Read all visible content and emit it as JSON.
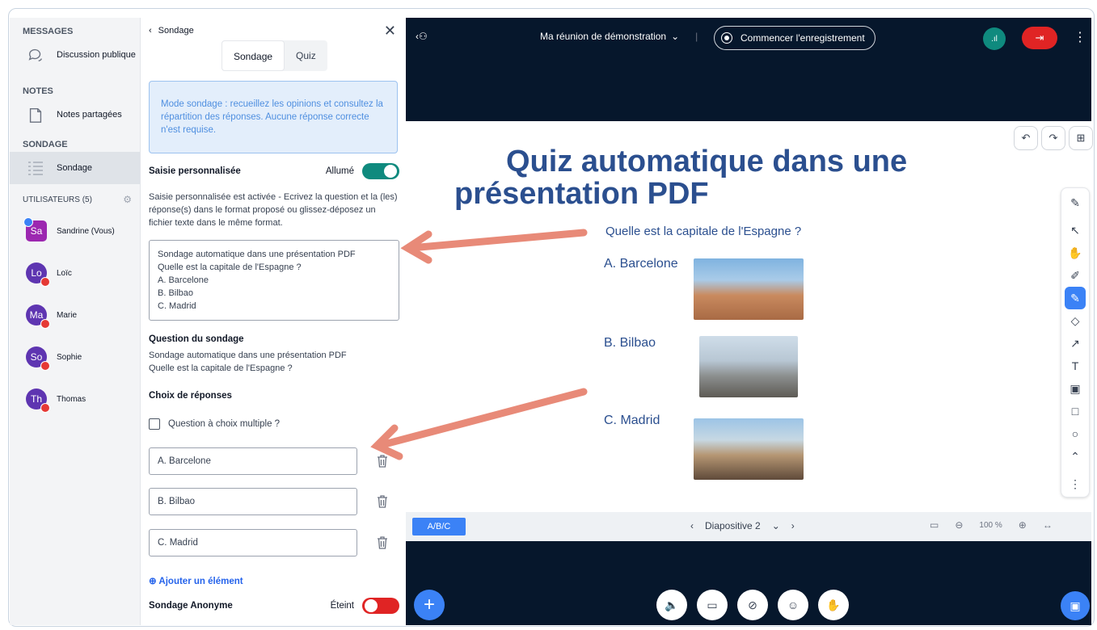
{
  "sidebar": {
    "messages_title": "MESSAGES",
    "public_chat": "Discussion publique",
    "notes_title": "NOTES",
    "shared_notes": "Notes partagées",
    "poll_title": "SONDAGE",
    "poll_item": "Sondage",
    "users_title": "UTILISATEURS (5)",
    "users": [
      {
        "initials": "Sa",
        "name": "Sandrine (Vous)",
        "color": "#9c27b0"
      },
      {
        "initials": "Lo",
        "name": "Loïc",
        "color": "#5e35b1"
      },
      {
        "initials": "Ma",
        "name": "Marie",
        "color": "#5e35b1"
      },
      {
        "initials": "So",
        "name": "Sophie",
        "color": "#5e35b1"
      },
      {
        "initials": "Th",
        "name": "Thomas",
        "color": "#5e35b1"
      }
    ]
  },
  "panel": {
    "back_label": "Sondage",
    "tabs": [
      "Sondage",
      "Quiz"
    ],
    "info": "Mode sondage : recueillez les opinions et consultez la répartition des réponses. Aucune réponse correcte n'est requise.",
    "custom_input_label": "Saisie personnalisée",
    "custom_input_state": "Allumé",
    "custom_input_desc": "Saisie personnalisée est activée - Ecrivez la question et la (les) réponse(s) dans le format proposé ou glissez-déposez un fichier texte dans le même format.",
    "textarea_lines": [
      "Sondage automatique dans une présentation PDF",
      "Quelle est la capitale de l'Espagne ?",
      "A. Barcelone",
      "B. Bilbao",
      "C. Madrid"
    ],
    "question_title": "Question du sondage",
    "question_line1": "Sondage automatique dans une présentation PDF",
    "question_line2": "Quelle est la capitale de l'Espagne ?",
    "choices_title": "Choix de réponses",
    "multiple_choice": "Question à choix multiple ?",
    "options": [
      "A. Barcelone",
      "B. Bilbao",
      "C. Madrid"
    ],
    "add_item": "Ajouter un élément",
    "anonymous_label": "Sondage Anonyme",
    "anonymous_state": "Éteint"
  },
  "topbar": {
    "meeting_title": "Ma réunion de démonstration",
    "record_label": "Commencer l'enregistrement"
  },
  "slide": {
    "title_line1": "Quiz  automatique dans une",
    "title_line2": "présentation PDF",
    "question": "Quelle est la capitale de l'Espagne ?",
    "opt_a": "A.  Barcelone",
    "opt_b": "B. Bilbao",
    "opt_c": "C. Madrid"
  },
  "slidebar": {
    "abc": "A/B/C",
    "slide_label": "Diapositive 2",
    "zoom": "100 %"
  },
  "colors": {
    "accent": "#3b82f6",
    "toggle_on": "#0f8a7e",
    "toggle_off": "#e02424",
    "arrow": "#e88a78"
  }
}
